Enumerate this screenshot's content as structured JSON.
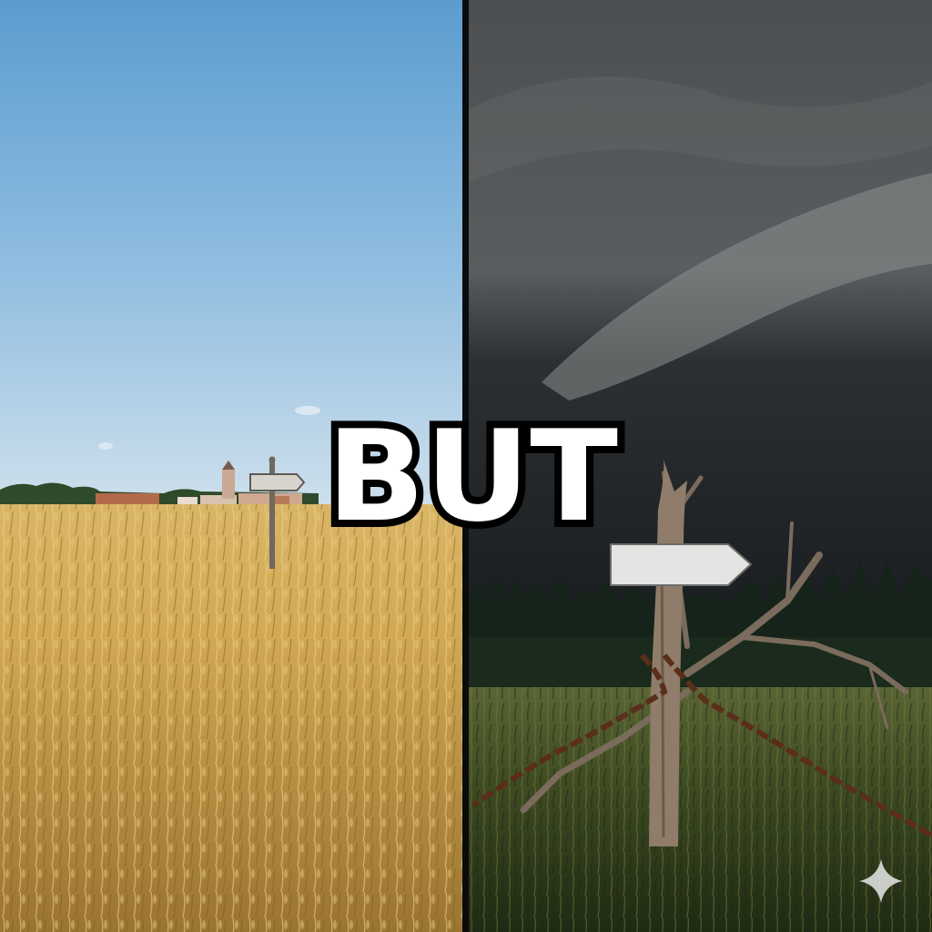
{
  "caption": {
    "text": "BUT"
  },
  "colors": {
    "sunny_sky_top": "#5b9ccf",
    "sunny_sky_bottom": "#c9dcea",
    "wheat_light": "#e2c070",
    "wheat_dark": "#8a6424",
    "storm_sky_top": "#4c4f51",
    "storm_sky_bottom": "#1b1f22",
    "forest": "#15231a",
    "meadow": "#3e4b22",
    "chain": "#5a2e1a",
    "caption_fill": "#ffffff",
    "caption_outline": "#000000"
  },
  "icons": {
    "watermark": "sparkle-icon",
    "sunny_sign": "signpost-icon",
    "storm_sign": "arrow-sign-icon"
  }
}
